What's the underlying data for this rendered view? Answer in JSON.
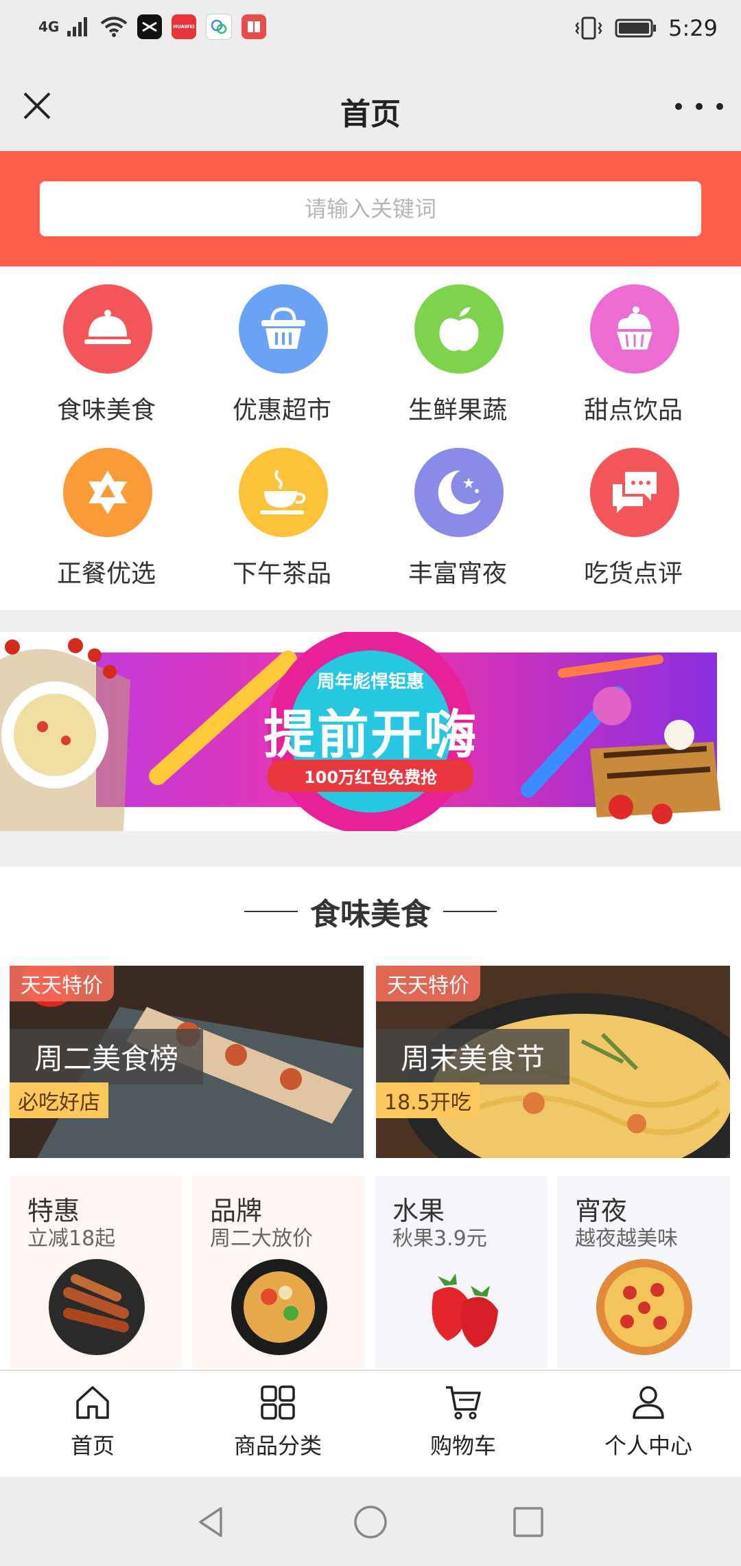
{
  "status_bar": {
    "network": "4G",
    "time": "5:29",
    "huawei_label": "HUAWEI"
  },
  "header": {
    "title": "首页"
  },
  "search": {
    "placeholder": "请输入关键词"
  },
  "categories": [
    {
      "label": "食味美食",
      "icon": "food-cover-icon",
      "color": "#f2555a"
    },
    {
      "label": "优惠超市",
      "icon": "basket-icon",
      "color": "#6aa2f5"
    },
    {
      "label": "生鲜果蔬",
      "icon": "apple-icon",
      "color": "#7ed34d"
    },
    {
      "label": "甜点饮品",
      "icon": "cupcake-icon",
      "color": "#ec6dd2"
    },
    {
      "label": "正餐优选",
      "icon": "star-of-david-icon",
      "color": "#fb9b38"
    },
    {
      "label": "下午茶品",
      "icon": "tea-cup-icon",
      "color": "#fcc23a"
    },
    {
      "label": "丰富宵夜",
      "icon": "moon-icon",
      "color": "#8a8be6"
    },
    {
      "label": "吃货点评",
      "icon": "chat-bubbles-icon",
      "color": "#f2555a"
    }
  ],
  "banner": {
    "kicker": "周年彪悍钜惠",
    "headline": "提前开嗨",
    "ribbon": "100万红包免费抢"
  },
  "section": {
    "title": "食味美食"
  },
  "promos": [
    {
      "tag": "天天特价",
      "name": "周二美食榜",
      "sub": "必吃好店"
    },
    {
      "tag": "天天特价",
      "name": "周末美食节",
      "sub": "18.5开吃"
    }
  ],
  "cards": [
    {
      "title": "特惠",
      "sub": "立减18起",
      "icon": "grilled-sausage-plate"
    },
    {
      "title": "品牌",
      "sub": "周二大放价",
      "icon": "noodle-bowl"
    },
    {
      "title": "水果",
      "sub": "秋果3.9元",
      "icon": "strawberries"
    },
    {
      "title": "宵夜",
      "sub": "越夜越美味",
      "icon": "pizza"
    }
  ],
  "tabbar": [
    {
      "label": "首页",
      "icon": "home-icon"
    },
    {
      "label": "商品分类",
      "icon": "grid-icon"
    },
    {
      "label": "购物车",
      "icon": "cart-icon"
    },
    {
      "label": "个人中心",
      "icon": "person-icon"
    }
  ],
  "colors": {
    "accent": "#ff5f4c",
    "tag": "#f56e5a",
    "highlight": "#fcc85c"
  }
}
